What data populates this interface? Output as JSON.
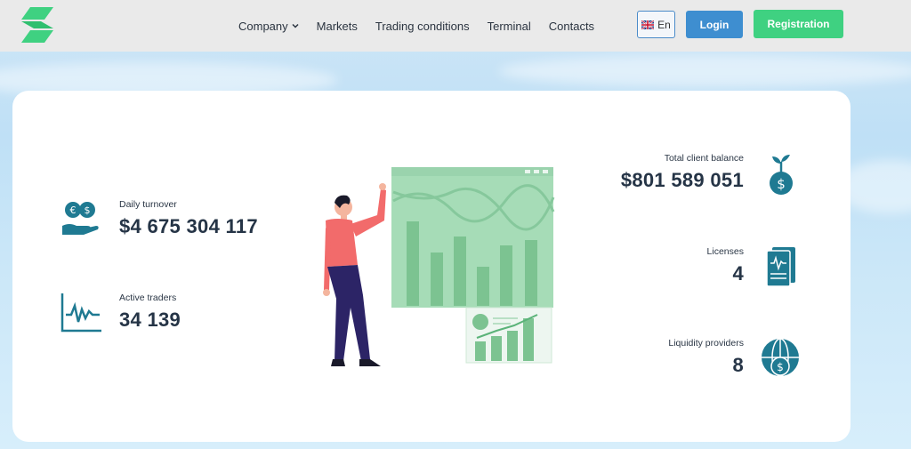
{
  "header": {
    "nav": [
      {
        "label": "Company",
        "has_dropdown": true
      },
      {
        "label": "Markets"
      },
      {
        "label": "Trading conditions"
      },
      {
        "label": "Terminal"
      },
      {
        "label": "Contacts"
      }
    ],
    "language": "En",
    "login_label": "Login",
    "registration_label": "Registration"
  },
  "stats": {
    "daily_turnover": {
      "label": "Daily turnover",
      "value": "$4 675 304 117"
    },
    "active_traders": {
      "label": "Active traders",
      "value": "34 139"
    },
    "total_client_balance": {
      "label": "Total client balance",
      "value": "$801 589 051"
    },
    "licenses": {
      "label": "Licenses",
      "value": "4"
    },
    "liquidity_providers": {
      "label": "Liquidity providers",
      "value": "8"
    }
  },
  "colors": {
    "logo_green": "#3fd181",
    "login_blue": "#3e8ed0",
    "registration_green": "#3fd181",
    "icon_teal": "#1f7a92",
    "chart_green": "#a6dcb7"
  }
}
